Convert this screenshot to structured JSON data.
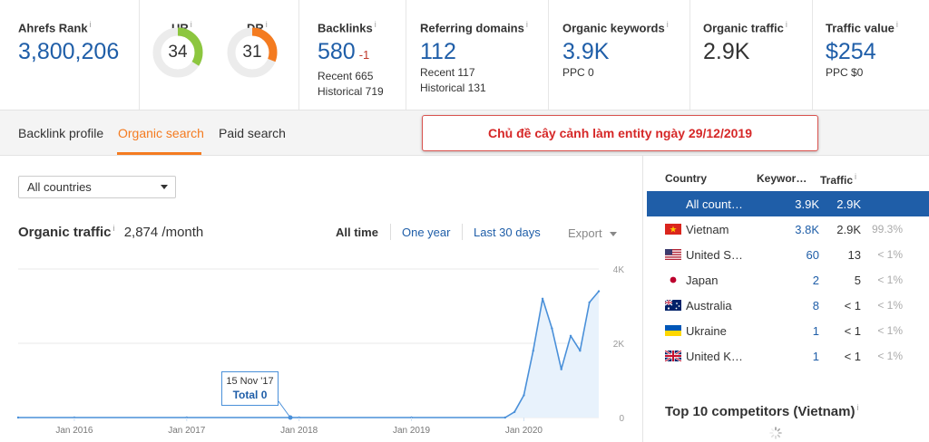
{
  "metrics": {
    "ahrefs_rank": {
      "title": "Ahrefs Rank",
      "value": "3,800,206"
    },
    "ur": {
      "title": "UR",
      "value": "34",
      "percent": 34,
      "color": "#8cc63f"
    },
    "dr": {
      "title": "DR",
      "value": "31",
      "percent": 31,
      "color": "#f47b20"
    },
    "backlinks": {
      "title": "Backlinks",
      "value": "580",
      "delta": "-1",
      "recent": "Recent 665",
      "historical": "Historical 719"
    },
    "ref_domains": {
      "title": "Referring domains",
      "value": "112",
      "recent": "Recent 117",
      "historical": "Historical 131"
    },
    "organic_keywords": {
      "title": "Organic keywords",
      "value": "3.9K",
      "ppc": "PPC 0"
    },
    "organic_traffic": {
      "title": "Organic traffic",
      "value": "2.9K"
    },
    "traffic_value": {
      "title": "Traffic value",
      "value": "$254",
      "ppc": "PPC $0"
    },
    "info_icon": "i"
  },
  "tabs": [
    {
      "label": "Backlink profile",
      "active": false
    },
    {
      "label": "Organic search",
      "active": true
    },
    {
      "label": "Paid search",
      "active": false
    }
  ],
  "banner": "Chủ đề cây cảnh làm entity ngày 29/12/2019",
  "country_select": "All countries",
  "traffic": {
    "title": "Organic traffic",
    "value": "2,874 /month",
    "ranges": [
      "All time",
      "One year",
      "Last 30 days"
    ],
    "export": "Export"
  },
  "tooltip": {
    "date": "15 Nov '17",
    "total": "Total 0"
  },
  "chart_data": {
    "type": "area",
    "x_tick_labels": [
      "Jan 2016",
      "Jan 2017",
      "Jan 2018",
      "Jan 2019",
      "Jan 2020"
    ],
    "y_tick_labels": [
      "4K",
      "2K",
      "0"
    ],
    "ylim": [
      0,
      4000
    ],
    "xlim": [
      "2015-07",
      "2020-09"
    ],
    "grid": true,
    "series": [
      {
        "x": [
          "2015-07",
          "2016-01",
          "2017-01",
          "2018-01",
          "2019-01",
          "2019-11",
          "2019-12",
          "2020-01",
          "2020-02",
          "2020-03",
          "2020-04",
          "2020-05",
          "2020-06",
          "2020-07",
          "2020-08",
          "2020-09"
        ],
        "values": [
          0,
          0,
          0,
          0,
          0,
          0,
          150,
          600,
          1800,
          3200,
          2400,
          1300,
          2200,
          1800,
          3100,
          3400
        ]
      }
    ],
    "colors": {
      "line": "#4a90d9",
      "fill": "#e8f2fc",
      "grid": "#e9e9e9",
      "axis": "#cfe0f2"
    }
  },
  "countries": {
    "headers": {
      "country": "Country",
      "keywords": "Keywor…",
      "traffic": "Traffic"
    },
    "rows": [
      {
        "flag": "",
        "name": "All count…",
        "keywords": "3.9K",
        "traffic": "2.9K",
        "pct": "",
        "selected": true
      },
      {
        "flag": "vn-flag-icon",
        "name": "Vietnam",
        "keywords": "3.8K",
        "traffic": "2.9K",
        "pct": "99.3%",
        "selected": false
      },
      {
        "flag": "us-flag-icon",
        "name": "United S…",
        "keywords": "60",
        "traffic": "13",
        "pct": "< 1%",
        "selected": false
      },
      {
        "flag": "jp-flag-icon",
        "name": "Japan",
        "keywords": "2",
        "traffic": "5",
        "pct": "< 1%",
        "selected": false
      },
      {
        "flag": "au-flag-icon",
        "name": "Australia",
        "keywords": "8",
        "traffic": "< 1",
        "pct": "< 1%",
        "selected": false
      },
      {
        "flag": "ua-flag-icon",
        "name": "Ukraine",
        "keywords": "1",
        "traffic": "< 1",
        "pct": "< 1%",
        "selected": false
      },
      {
        "flag": "uk-flag-icon",
        "name": "United K…",
        "keywords": "1",
        "traffic": "< 1",
        "pct": "< 1%",
        "selected": false
      }
    ]
  },
  "competitors_title": "Top 10 competitors (Vietnam)"
}
